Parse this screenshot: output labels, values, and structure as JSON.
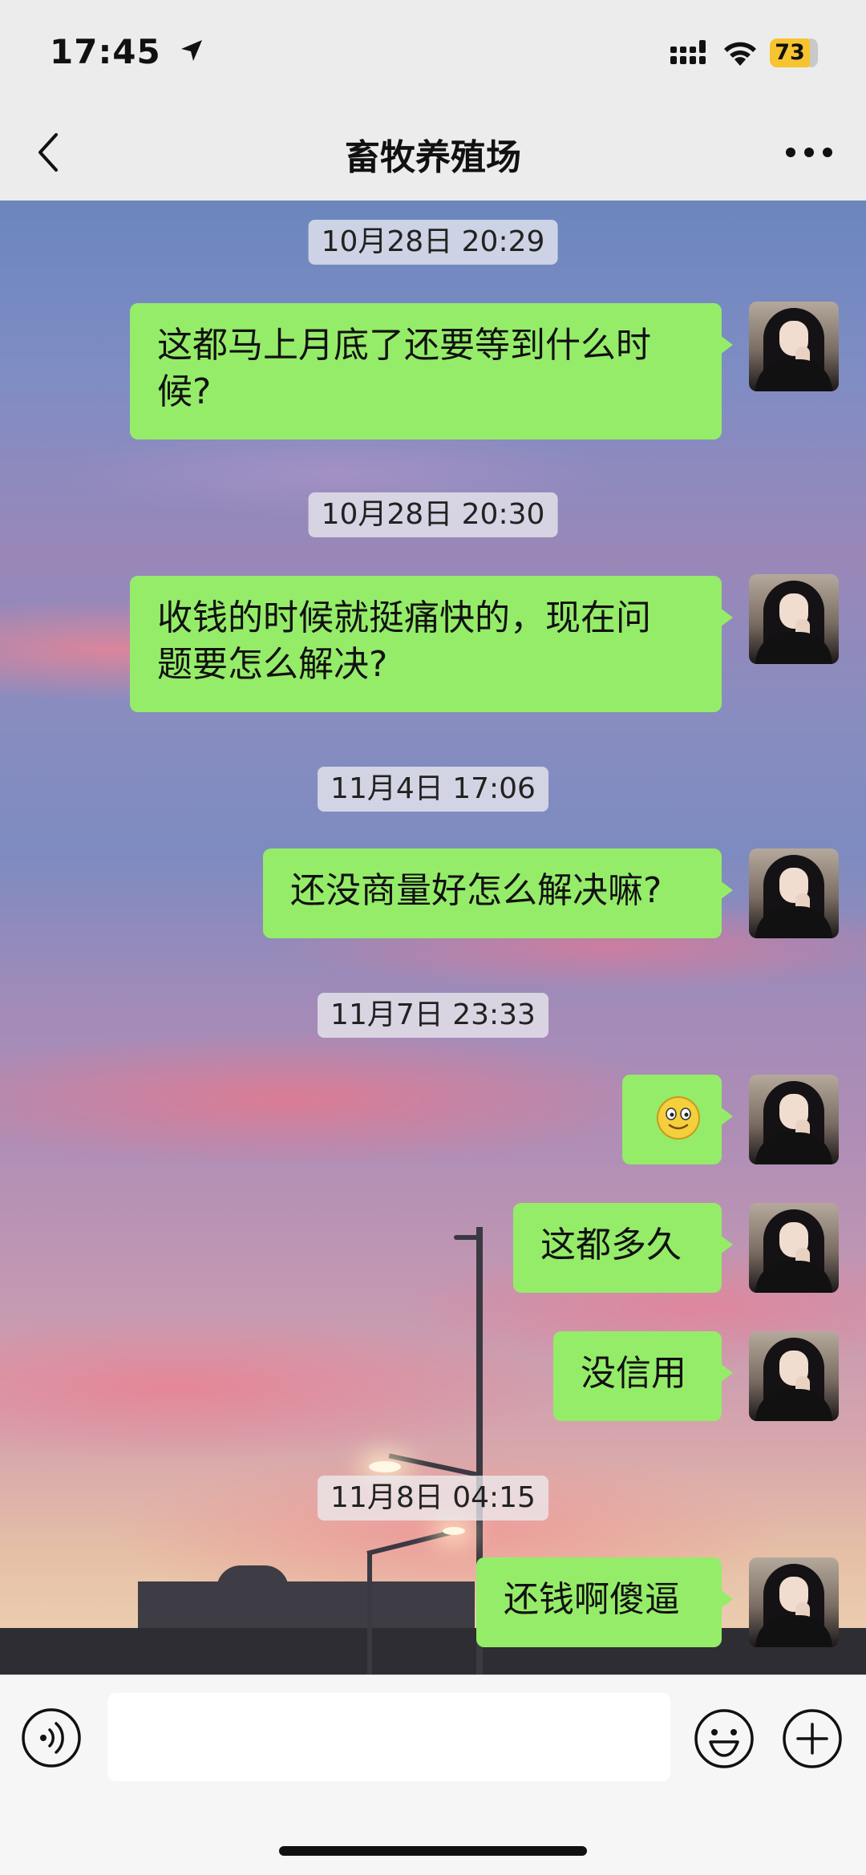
{
  "status_bar": {
    "time": "17:45",
    "battery_level": "73",
    "location_icon": "location-arrow-icon",
    "signal_icon": "cellular-signal-icon",
    "wifi_icon": "wifi-icon"
  },
  "header": {
    "title": "畜牧养殖场",
    "back_icon": "chevron-left-icon",
    "more_icon": "more-dots-icon"
  },
  "chat": {
    "timestamps": [
      "10月28日 20:29",
      "10月28日 20:30",
      "11月4日 17:06",
      "11月7日 23:33",
      "11月8日 04:15"
    ],
    "messages": [
      {
        "sender": "self",
        "line1": "这都马上月底了还要等到什么时",
        "line2": "候?"
      },
      {
        "sender": "self",
        "line1": "收钱的时候就挺痛快的，现在问",
        "line2": "题要怎么解决?"
      },
      {
        "sender": "self",
        "text": "还没商量好怎么解决嘛?"
      },
      {
        "sender": "self",
        "emoji": "smile-emoji"
      },
      {
        "sender": "self",
        "text": "这都多久"
      },
      {
        "sender": "self",
        "text": "没信用"
      },
      {
        "sender": "self",
        "text": "还钱啊傻逼"
      }
    ]
  },
  "input_bar": {
    "voice_icon": "voice-input-icon",
    "emoji_icon": "emoji-icon",
    "plus_icon": "plus-icon",
    "text_value": ""
  },
  "colors": {
    "bubble": "#95ec69",
    "bar_background": "#ececec",
    "battery": "#f6c42f"
  }
}
